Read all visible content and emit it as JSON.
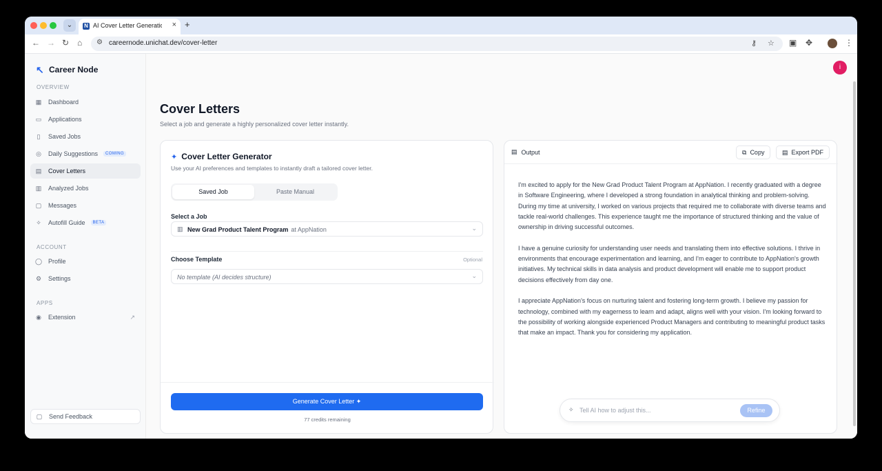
{
  "browser": {
    "tab_title": "AI Cover Letter Generation | C",
    "url": "careernode.unichat.dev/cover-letter"
  },
  "brand": {
    "name": "Career Node"
  },
  "sidebar": {
    "overview_label": "OVERVIEW",
    "items": [
      {
        "label": "Dashboard",
        "icon": "dashboard-icon"
      },
      {
        "label": "Applications",
        "icon": "briefcase-icon"
      },
      {
        "label": "Saved Jobs",
        "icon": "bookmark-icon"
      },
      {
        "label": "Daily Suggestions",
        "icon": "target-icon",
        "badge": "COMING"
      },
      {
        "label": "Cover Letters",
        "icon": "document-icon",
        "active": true
      },
      {
        "label": "Analyzed Jobs",
        "icon": "analysis-icon"
      },
      {
        "label": "Messages",
        "icon": "message-icon"
      },
      {
        "label": "Autofill Guide",
        "icon": "wand-icon",
        "badge": "BETA"
      }
    ],
    "account_label": "ACCOUNT",
    "account_items": [
      {
        "label": "Profile",
        "icon": "user-icon"
      },
      {
        "label": "Settings",
        "icon": "gear-icon"
      }
    ],
    "apps_label": "APPS",
    "apps_items": [
      {
        "label": "Extension",
        "icon": "chrome-icon"
      }
    ],
    "feedback_label": "Send Feedback"
  },
  "user": {
    "avatar_initial": "i"
  },
  "page": {
    "title": "Cover Letters",
    "subtitle": "Select a job and generate a highly personalized cover letter instantly."
  },
  "generator": {
    "title": "Cover Letter Generator",
    "subtitle": "Use your AI preferences and templates to instantly draft a tailored cover letter.",
    "tabs": [
      "Saved Job",
      "Paste Manual"
    ],
    "select_job_label": "Select a Job",
    "selected_job": "New Grad Product Talent Program",
    "selected_company": "at AppNation",
    "template_label": "Choose Template",
    "template_optional": "Optional",
    "template_placeholder": "No template (AI decides structure)",
    "generate_label": "Generate Cover Letter",
    "credits": "77 credits remaining"
  },
  "output": {
    "label": "Output",
    "copy_label": "Copy",
    "export_label": "Export PDF",
    "paragraphs": [
      "I'm excited to apply for the New Grad Product Talent Program at AppNation. I recently graduated with a degree in Software Engineering, where I developed a strong foundation in analytical thinking and problem-solving. During my time at university, I worked on various projects that required me to collaborate with diverse teams and tackle real-world challenges. This experience taught me the importance of structured thinking and the value of ownership in driving successful outcomes.",
      "I have a genuine curiosity for understanding user needs and translating them into effective solutions. I thrive in environments that encourage experimentation and learning, and I'm eager to contribute to AppNation's growth initiatives. My technical skills in data analysis and product development will enable me to support product decisions effectively from day one.",
      "I appreciate AppNation's focus on nurturing talent and fostering long-term growth. I believe my passion for technology, combined with my eagerness to learn and adapt, aligns well with your vision. I'm looking forward to the possibility of working alongside experienced Product Managers and contributing to meaningful product tasks that make an impact. Thank you for considering my application."
    ],
    "refine_placeholder": "Tell AI how to adjust this...",
    "refine_label": "Refine"
  }
}
